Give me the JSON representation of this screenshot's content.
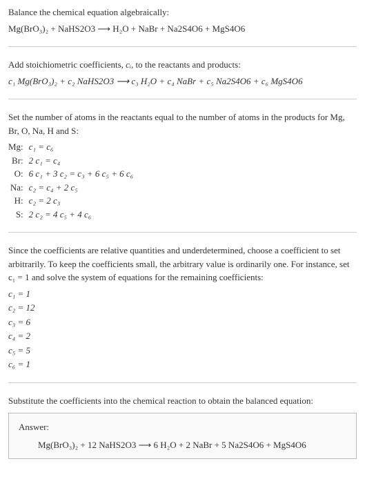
{
  "intro": {
    "line1": "Balance the chemical equation algebraically:",
    "equation": "Mg(BrO₃)₂ + NaHS2O3  ⟶  H₂O + NaBr + Na2S4O6 + MgS4O6"
  },
  "stoich": {
    "line1_prefix": "Add stoichiometric coefficients, ",
    "line1_var": "cᵢ",
    "line1_suffix": ", to the reactants and products:",
    "equation": "c₁ Mg(BrO₃)₂ + c₂ NaHS2O3  ⟶  c₃ H₂O + c₄ NaBr + c₅ Na2S4O6 + c₆ MgS4O6"
  },
  "atoms": {
    "intro": "Set the number of atoms in the reactants equal to the number of atoms in the products for Mg, Br, O, Na, H and S:",
    "rows": [
      {
        "label": "Mg:",
        "eq": "c₁ = c₆"
      },
      {
        "label": "Br:",
        "eq": "2 c₁ = c₄"
      },
      {
        "label": "O:",
        "eq": "6 c₁ + 3 c₂ = c₃ + 6 c₅ + 6 c₆"
      },
      {
        "label": "Na:",
        "eq": "c₂ = c₄ + 2 c₅"
      },
      {
        "label": "H:",
        "eq": "c₂ = 2 c₃"
      },
      {
        "label": "S:",
        "eq": "2 c₂ = 4 c₅ + 4 c₆"
      }
    ]
  },
  "solve": {
    "intro": "Since the coefficients are relative quantities and underdetermined, choose a coefficient to set arbitrarily. To keep the coefficients small, the arbitrary value is ordinarily one. For instance, set c₁ = 1 and solve the system of equations for the remaining coefficients:",
    "coeffs": [
      "c₁ = 1",
      "c₂ = 12",
      "c₃ = 6",
      "c₄ = 2",
      "c₅ = 5",
      "c₆ = 1"
    ]
  },
  "substitute": {
    "intro": "Substitute the coefficients into the chemical reaction to obtain the balanced equation:"
  },
  "answer": {
    "label": "Answer:",
    "equation": "Mg(BrO₃)₂ + 12 NaHS2O3  ⟶  6 H₂O + 2 NaBr + 5 Na2S4O6 + MgS4O6"
  }
}
